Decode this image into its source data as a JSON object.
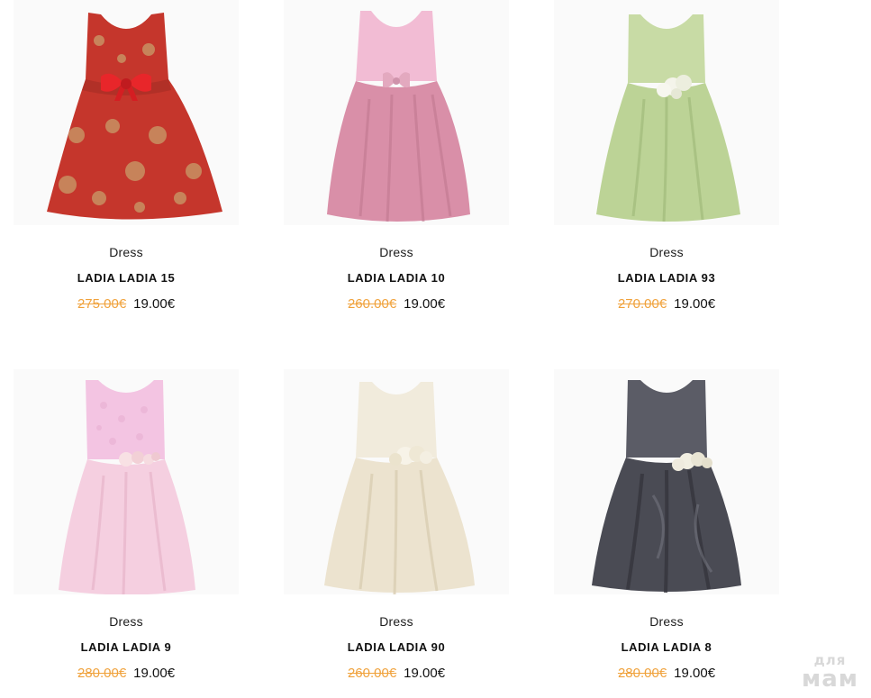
{
  "products": [
    {
      "category": "Dress",
      "name": "LADIA LADIA 15",
      "old_price": "275.00€",
      "new_price": "19.00€",
      "image": "red-brocade-dress-with-bow",
      "colors": {
        "main": "#c5362c",
        "accent": "#b8a06a",
        "bow": "#e8262a"
      }
    },
    {
      "category": "Dress",
      "name": "LADIA LADIA 10",
      "old_price": "260.00€",
      "new_price": "19.00€",
      "image": "pink-satin-dress-with-bow",
      "colors": {
        "bodice": "#f2bcd4",
        "skirt": "#d98fa8",
        "bow": "#e3a9bf"
      }
    },
    {
      "category": "Dress",
      "name": "LADIA LADIA 93",
      "old_price": "270.00€",
      "new_price": "19.00€",
      "image": "green-satin-dress-with-flower",
      "colors": {
        "main": "#c8dba5",
        "shade": "#aac483",
        "flower": "#f4f4ea"
      }
    },
    {
      "category": "Dress",
      "name": "LADIA LADIA 9",
      "old_price": "280.00€",
      "new_price": "19.00€",
      "image": "light-pink-lace-dress",
      "colors": {
        "bodice": "#f3c4e2",
        "skirt": "#f5cfe0",
        "flower": "#f8e1e4"
      }
    },
    {
      "category": "Dress",
      "name": "LADIA LADIA 90",
      "old_price": "260.00€",
      "new_price": "19.00€",
      "image": "ivory-satin-dress-with-flower",
      "colors": {
        "main": "#f1ebdc",
        "shade": "#d9cdb2",
        "flower": "#f7f3e8"
      }
    },
    {
      "category": "Dress",
      "name": "LADIA LADIA 8",
      "old_price": "280.00€",
      "new_price": "19.00€",
      "image": "grey-taffeta-dress-with-flower",
      "colors": {
        "main": "#5b5c66",
        "shade": "#3a3b42",
        "flower": "#f2efe2"
      }
    }
  ],
  "watermark": {
    "top": "для",
    "bottom": "мам"
  }
}
